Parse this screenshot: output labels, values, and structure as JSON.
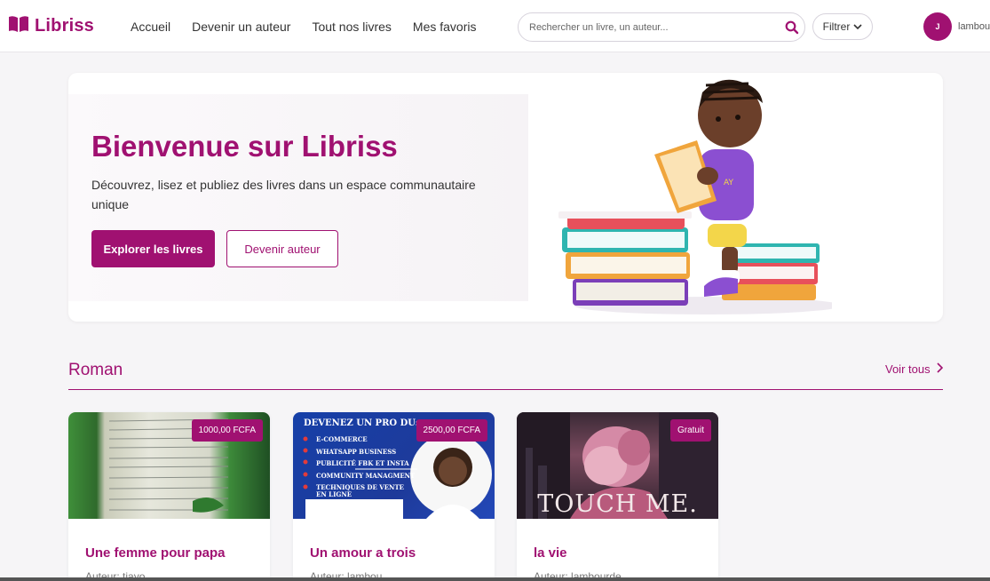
{
  "brand": {
    "name": "Libriss",
    "color": "#a01171"
  },
  "nav": {
    "items": [
      "Accueil",
      "Devenir un auteur",
      "Tout nos livres",
      "Mes favoris"
    ]
  },
  "search": {
    "placeholder": "Rechercher un livre, un auteur..."
  },
  "filter": {
    "label": "Filtrer"
  },
  "user": {
    "initial": "J",
    "name": "lambou"
  },
  "hero": {
    "title": "Bienvenue sur Libriss",
    "subtitle": "Découvrez, lisez et publiez des livres dans un espace communautaire unique",
    "primary_button": "Explorer les livres",
    "secondary_button": "Devenir auteur"
  },
  "section": {
    "title": "Roman",
    "see_all": "Voir tous"
  },
  "books": [
    {
      "title": "Une femme pour papa",
      "author": "Auteur: tiayo",
      "price": "1000,00 FCFA"
    },
    {
      "title": "Un amour a trois",
      "author": "Auteur: lambou",
      "price": "2500,00 FCFA",
      "cover_text": {
        "heading": "DEVENEZ UN PRO DU:",
        "items": [
          "E-COMMERCE",
          "WHATSAPP BUSINESS",
          "PUBLICITÉ FBK ET INSTA",
          "COMMUNITY MANAGMENT",
          "TECHNIQUES DE VENTE EN LIGNE"
        ]
      }
    },
    {
      "title": "la vie",
      "author": "Auteur: lambourde",
      "price": "Gratuit",
      "cover_text": {
        "heading": "TOUCH ME."
      }
    }
  ]
}
